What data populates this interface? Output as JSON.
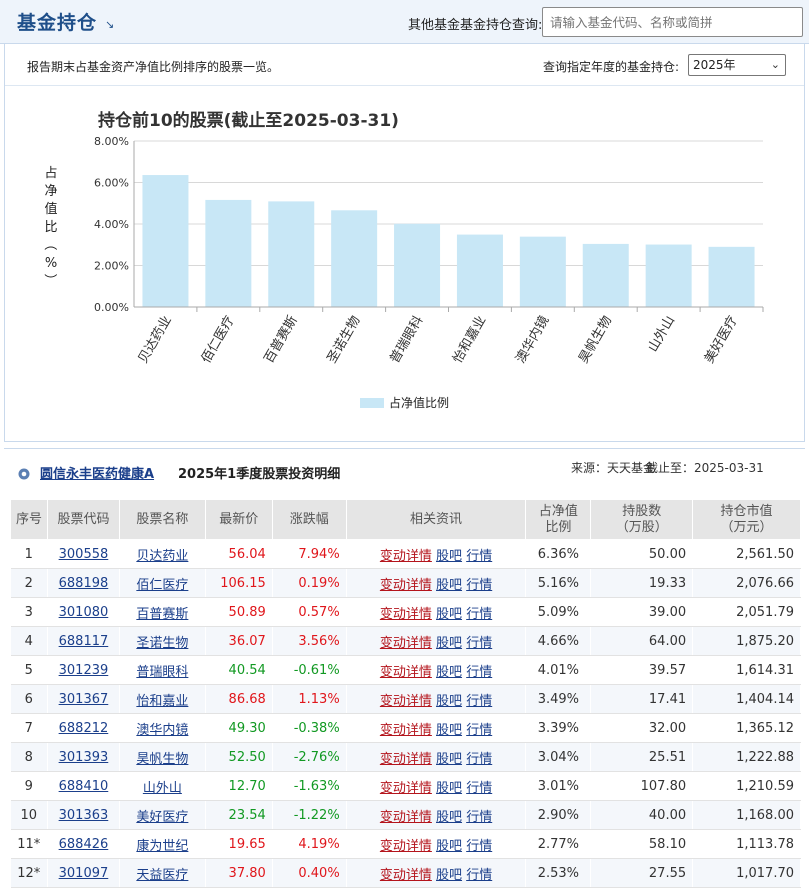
{
  "header": {
    "title": "基金持仓",
    "title_icon": "arrow-down-right-icon",
    "search_label": "其他基金基金持仓查询:",
    "search_placeholder": "请输入基金代码、名称或简拼"
  },
  "toolbar": {
    "description": "报告期末占基金资产净值比例排序的股票一览。",
    "year_label": "查询指定年度的基金持仓:",
    "year_value": "2025年"
  },
  "chart_data": {
    "type": "bar",
    "title": "持仓前10的股票(截止至2025-03-31)",
    "ylabel": "占净值比（%）",
    "ylim": [
      0,
      8
    ],
    "yticks": [
      "0.00%",
      "2.00%",
      "4.00%",
      "6.00%",
      "8.00%"
    ],
    "categories": [
      "贝达药业",
      "佰仁医疗",
      "百普赛斯",
      "圣诺生物",
      "普瑞眼科",
      "怡和嘉业",
      "澳华内镜",
      "昊帆生物",
      "山外山",
      "美好医疗"
    ],
    "series": [
      {
        "name": "占净值比例",
        "values": [
          6.36,
          5.16,
          5.09,
          4.66,
          4.01,
          3.49,
          3.39,
          3.04,
          3.01,
          2.9
        ]
      }
    ],
    "bar_color": "#c8e7f6",
    "grid": true,
    "legend": "bottom-center"
  },
  "section": {
    "fund_name": "圆信永丰医药健康A",
    "title": "2025年1季度股票投资明细",
    "source": "来源：天天基金",
    "cutoff": "截止至：2025-03-31"
  },
  "table": {
    "headers": {
      "seq": "序号",
      "code": "股票代码",
      "name": "股票名称",
      "price": "最新价",
      "change": "涨跌幅",
      "news": "相关资讯",
      "ratio": "占净值比例",
      "shares": "持股数（万股）",
      "value": "持仓市值（万元）"
    },
    "link_labels": {
      "detail": "变动详情",
      "forum": "股吧",
      "quote": "行情"
    },
    "rows": [
      {
        "seq": "1",
        "code": "300558",
        "name": "贝达药业",
        "price": "56.04",
        "change": "7.94%",
        "dir": "up",
        "ratio": "6.36%",
        "shares": "50.00",
        "value": "2,561.50"
      },
      {
        "seq": "2",
        "code": "688198",
        "name": "佰仁医疗",
        "price": "106.15",
        "change": "0.19%",
        "dir": "up",
        "ratio": "5.16%",
        "shares": "19.33",
        "value": "2,076.66"
      },
      {
        "seq": "3",
        "code": "301080",
        "name": "百普赛斯",
        "price": "50.89",
        "change": "0.57%",
        "dir": "up",
        "ratio": "5.09%",
        "shares": "39.00",
        "value": "2,051.79"
      },
      {
        "seq": "4",
        "code": "688117",
        "name": "圣诺生物",
        "price": "36.07",
        "change": "3.56%",
        "dir": "up",
        "ratio": "4.66%",
        "shares": "64.00",
        "value": "1,875.20"
      },
      {
        "seq": "5",
        "code": "301239",
        "name": "普瑞眼科",
        "price": "40.54",
        "change": "-0.61%",
        "dir": "down",
        "ratio": "4.01%",
        "shares": "39.57",
        "value": "1,614.31"
      },
      {
        "seq": "6",
        "code": "301367",
        "name": "怡和嘉业",
        "price": "86.68",
        "change": "1.13%",
        "dir": "up",
        "ratio": "3.49%",
        "shares": "17.41",
        "value": "1,404.14"
      },
      {
        "seq": "7",
        "code": "688212",
        "name": "澳华内镜",
        "price": "49.30",
        "change": "-0.38%",
        "dir": "down",
        "ratio": "3.39%",
        "shares": "32.00",
        "value": "1,365.12"
      },
      {
        "seq": "8",
        "code": "301393",
        "name": "昊帆生物",
        "price": "52.50",
        "change": "-2.76%",
        "dir": "down",
        "ratio": "3.04%",
        "shares": "25.51",
        "value": "1,222.88"
      },
      {
        "seq": "9",
        "code": "688410",
        "name": "山外山",
        "price": "12.70",
        "change": "-1.63%",
        "dir": "down",
        "ratio": "3.01%",
        "shares": "107.80",
        "value": "1,210.59"
      },
      {
        "seq": "10",
        "code": "301363",
        "name": "美好医疗",
        "price": "23.54",
        "change": "-1.22%",
        "dir": "down",
        "ratio": "2.90%",
        "shares": "40.00",
        "value": "1,168.00"
      },
      {
        "seq": "11*",
        "code": "688426",
        "name": "康为世纪",
        "price": "19.65",
        "change": "4.19%",
        "dir": "up",
        "ratio": "2.77%",
        "shares": "58.10",
        "value": "1,113.78"
      },
      {
        "seq": "12*",
        "code": "301097",
        "name": "天益医疗",
        "price": "37.80",
        "change": "0.40%",
        "dir": "up",
        "ratio": "2.53%",
        "shares": "27.55",
        "value": "1,017.70"
      }
    ]
  }
}
